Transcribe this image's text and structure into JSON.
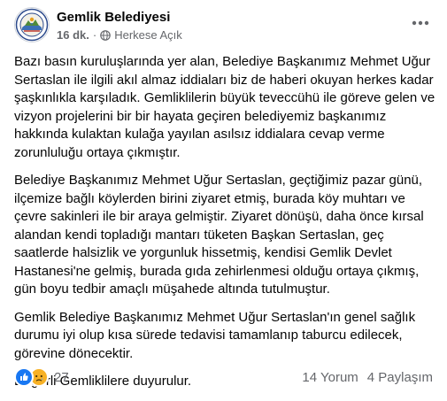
{
  "post": {
    "page_name": "Gemlik Belediyesi",
    "time": "16 dk.",
    "separator": "·",
    "audience": "Herkese Açık",
    "audience_icon": "globe-icon",
    "paragraphs": [
      "Bazı basın kuruluşlarında yer alan, Belediye Başkanımız Mehmet Uğur Sertaslan ile ilgili akıl almaz iddiaları biz de haberi okuyan herkes kadar şaşkınlıkla karşıladık. Gemliklilerin büyük teveccühü ile göreve gelen ve vizyon projelerini bir bir hayata geçiren belediyemiz başkanımız hakkında kulaktan kulağa yayılan asılsız iddialara cevap verme zorunluluğu ortaya çıkmıştır.",
      "Belediye Başkanımız Mehmet Uğur Sertaslan, geçtiğimiz pazar günü, ilçemize bağlı köylerden birini ziyaret etmiş, burada köy muhtarı ve çevre sakinleri ile bir araya gelmiştir. Ziyaret dönüşü, daha önce kırsal alandan kendi topladığı mantarı tüketen Başkan Sertaslan, geç saatlerde halsizlik ve yorgunluk hissetmiş, kendisi Gemlik Devlet Hastanesi'ne gelmiş, burada gıda zehirlenmesi olduğu ortaya çıkmış, gün boyu tedbir amaçlı müşahede altında tutulmuştur.",
      "Gemlik Belediye Başkanımız Mehmet Uğur Sertaslan'ın genel sağlık durumu iyi olup kısa sürede tedavisi tamamlanıp taburcu edilecek, görevine dönecektir.",
      "Değerli Gemliklilere duyurulur."
    ]
  },
  "footer": {
    "reaction_icons": [
      "like-icon",
      "sad-icon"
    ],
    "reaction_count": "27",
    "comments": "14 Yorum",
    "shares": "4 Paylaşım"
  },
  "colors": {
    "like_blue": "#1877f2",
    "sad_yellow": "#f7b125",
    "secondary_text": "#65676b"
  }
}
